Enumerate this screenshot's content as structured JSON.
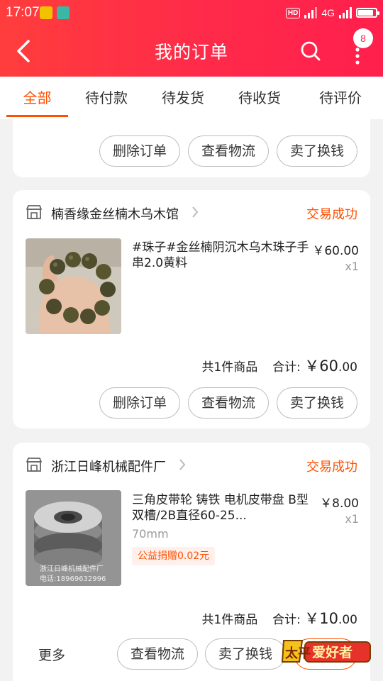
{
  "status_bar": {
    "time": "17:07",
    "hd": "HD",
    "network": "4G"
  },
  "navbar": {
    "title": "我的订单",
    "badge": "8"
  },
  "tabs": [
    {
      "label": "全部",
      "active": true
    },
    {
      "label": "待付款",
      "active": false
    },
    {
      "label": "待发货",
      "active": false
    },
    {
      "label": "待收货",
      "active": false
    },
    {
      "label": "待评价",
      "active": false
    }
  ],
  "top_card": {
    "buttons": [
      "删除订单",
      "查看物流",
      "卖了换钱"
    ]
  },
  "order1": {
    "shop": "楠香缘金丝楠木乌木馆",
    "status": "交易成功",
    "title": "#珠子#金丝楠阴沉木乌木珠子手串2.0黄料",
    "price": "￥60.00",
    "qty": "x1",
    "count_text": "共1件商品",
    "total_label": "合计:",
    "total_int": "￥60",
    "total_dec": ".00",
    "buttons": [
      "删除订单",
      "查看物流",
      "卖了换钱"
    ]
  },
  "order2": {
    "shop": "浙江日峰机械配件厂",
    "status": "交易成功",
    "title": "三角皮带轮 铸铁 电机皮带盘 B型双槽/2B直径60-25...",
    "spec": "70mm",
    "donation": "公益捐赠0.02元",
    "price": "￥8.00",
    "qty": "x1",
    "image_caption": "浙江日峰机械配件厂",
    "image_phone": "电话:18969632996",
    "count_text": "共1件商品",
    "total_label": "合计:",
    "total_int": "￥10",
    "total_dec": ".00",
    "more": "更多",
    "buttons": [
      "查看物流",
      "卖了换钱"
    ]
  },
  "watermark": {
    "text_a": "太平",
    "text_b": "爱好者"
  },
  "colors": {
    "brand": "#ff2a4a",
    "accent": "#ff5000"
  }
}
